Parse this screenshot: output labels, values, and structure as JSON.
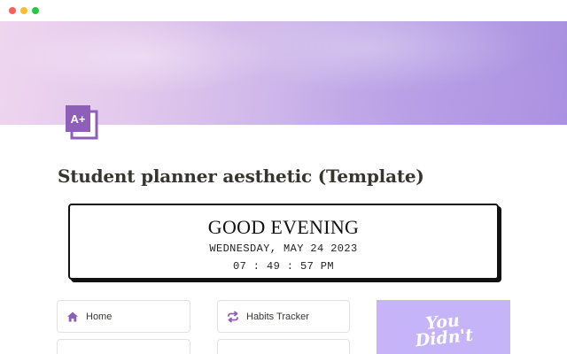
{
  "window": {
    "controls": [
      "close",
      "minimize",
      "zoom"
    ]
  },
  "page": {
    "icon": "a-plus-document-icon",
    "icon_text": "A+",
    "title": "Student planner aesthetic (Template)"
  },
  "clock": {
    "greeting": "GOOD EVENING",
    "date": "WEDNESDAY, MAY 24 2023",
    "time": "07 : 49 : 57 PM"
  },
  "nav": {
    "items": [
      {
        "label": "Home",
        "icon": "home-icon"
      },
      {
        "label": "Habits Tracker",
        "icon": "repeat-arrows-icon"
      }
    ]
  },
  "quote": {
    "line1": "You",
    "line2": "Didn't"
  },
  "colors": {
    "accent_purple": "#8e5fb8",
    "quote_bg": "#c6b4f8",
    "title_text": "#37352f"
  }
}
